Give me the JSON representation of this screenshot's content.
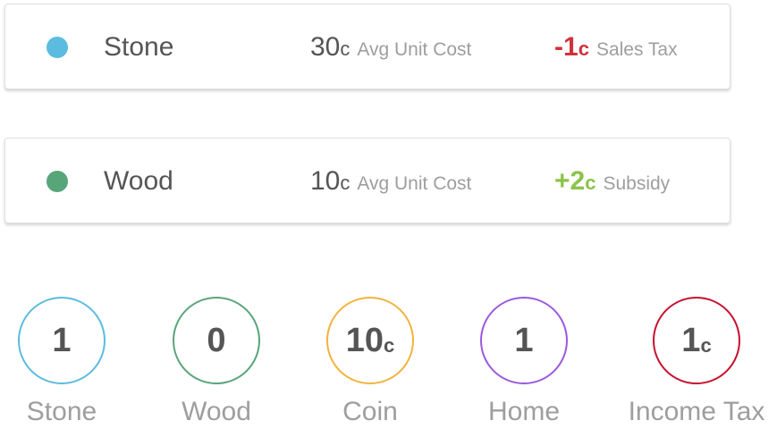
{
  "colors": {
    "stone": "#5bbcdf",
    "wood": "#58a57a",
    "coin": "#f2b33d",
    "home": "#9b59e0",
    "income_tax": "#c8102e",
    "negative": "#d0323c",
    "positive": "#8bc34a"
  },
  "resources": [
    {
      "name": "Stone",
      "cost_value": "30",
      "cost_unit": "c",
      "cost_label": "Avg Unit Cost",
      "mod_value": "-1",
      "mod_unit": "c",
      "mod_label": "Sales Tax"
    },
    {
      "name": "Wood",
      "cost_value": "10",
      "cost_unit": "c",
      "cost_label": "Avg Unit Cost",
      "mod_value": "+2",
      "mod_unit": "c",
      "mod_label": "Subsidy"
    }
  ],
  "stats": [
    {
      "value": "1",
      "unit": "",
      "label": "Stone"
    },
    {
      "value": "0",
      "unit": "",
      "label": "Wood"
    },
    {
      "value": "10",
      "unit": "c",
      "label": "Coin"
    },
    {
      "value": "1",
      "unit": "",
      "label": "Home"
    },
    {
      "value": "1",
      "unit": "c",
      "label": "Income Tax"
    }
  ]
}
